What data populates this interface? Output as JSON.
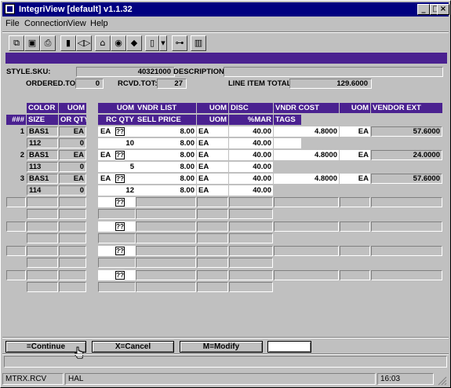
{
  "window": {
    "title": "IntegriView [default]  v1.1.32",
    "min": "_",
    "max": "□",
    "close": "×"
  },
  "menu": [
    "File",
    "Connection",
    "View",
    "Help"
  ],
  "toolbar_icons": [
    "copy-icon",
    "save-icon",
    "print-icon",
    "lock-icon",
    "audio-icon",
    "network-icon",
    "monitor-icon",
    "tag-icon",
    "page-icon",
    "dropdown-icon",
    "tree-icon",
    "chart-icon"
  ],
  "form": {
    "style_sku_label": "STYLE.SKU:",
    "style_sku": "40321000",
    "description_label": "DESCRIPTION:",
    "description": "",
    "ordered_tot_label": "ORDERED.TOT:",
    "ordered_tot": "0",
    "rcvd_tot_label": "RCVD.TOT:",
    "rcvd_tot": "27",
    "line_item_total_label": "LINE ITEM TOTAL",
    "line_item_total": "129.6000"
  },
  "grid": {
    "headers_row1": [
      "COLOR",
      "UOM",
      "UOM",
      "VNDR LIST",
      "UOM",
      "DISC",
      "VNDR COST",
      "UOM",
      "VENDOR EXT"
    ],
    "headers_row2": [
      "###",
      "SIZE",
      "OR QTY",
      "RC QTY",
      "SELL PRICE",
      "UOM",
      "%MAR",
      "TAGS"
    ],
    "items": [
      {
        "num": "1",
        "color": "BAS1",
        "uom": "EA",
        "uom2": "EA",
        "qicon": "??",
        "vndr_list": "8.00",
        "uom3": "EA",
        "disc": "40.00",
        "vndr_cost": "4.8000",
        "uom4": "EA",
        "vendor_ext": "57.6000",
        "size": "112",
        "or_qty": "0",
        "rc_qty": "10",
        "sell_price": "8.00",
        "uom5": "EA",
        "mar": "40.00"
      },
      {
        "num": "2",
        "color": "BAS1",
        "uom": "EA",
        "uom2": "EA",
        "qicon": "??",
        "vndr_list": "8.00",
        "uom3": "EA",
        "disc": "40.00",
        "vndr_cost": "4.8000",
        "uom4": "EA",
        "vendor_ext": "24.0000",
        "size": "113",
        "or_qty": "0",
        "rc_qty": "5",
        "sell_price": "8.00",
        "uom5": "EA",
        "mar": "40.00"
      },
      {
        "num": "3",
        "color": "BAS1",
        "uom": "EA",
        "uom2": "EA",
        "qicon": "??",
        "vndr_list": "8.00",
        "uom3": "EA",
        "disc": "40.00",
        "vndr_cost": "4.8000",
        "uom4": "EA",
        "vendor_ext": "57.6000",
        "size": "114",
        "or_qty": "0",
        "rc_qty": "12",
        "sell_price": "8.00",
        "uom5": "EA",
        "mar": "40.00"
      }
    ],
    "empty_qicon": "??"
  },
  "buttons": {
    "continue": "=Continue",
    "cancel": "X=Cancel",
    "modify": "M=Modify",
    "extra": ""
  },
  "status": {
    "program": "MTRX.RCV",
    "user": "HAL",
    "time": "16:03"
  },
  "colors": {
    "title_bar": "#000080",
    "header_purple": "#4a2190",
    "window_gray": "#c0c0c0"
  }
}
